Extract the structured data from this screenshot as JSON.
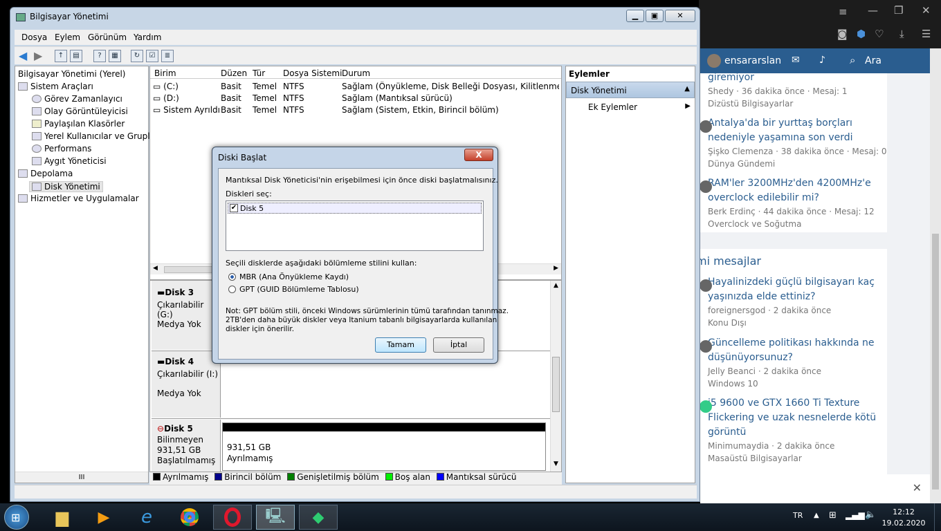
{
  "window": {
    "title": "Bilgisayar Yönetimi"
  },
  "menu": [
    "Dosya",
    "Eylem",
    "Görünüm",
    "Yardım"
  ],
  "tree": {
    "root": "Bilgisayar Yönetimi (Yerel)",
    "items": [
      "Sistem Araçları",
      "Görev Zamanlayıcı",
      "Olay Görüntüleyicisi",
      "Paylaşılan Klasörler",
      "Yerel Kullanıcılar ve Gruplar",
      "Performans",
      "Aygıt Yöneticisi",
      "Depolama",
      "Disk Yönetimi",
      "Hizmetler ve Uygulamalar"
    ],
    "scroll": "III"
  },
  "volumes": {
    "headers": [
      "Birim",
      "Düzen",
      "Tür",
      "Dosya Sistemi",
      "Durum"
    ],
    "rows": [
      [
        "(C:)",
        "Basit",
        "Temel",
        "NTFS",
        "Sağlam (Önyükleme, Disk Belleği Dosyası, Kilitlenme Bilgisi, B"
      ],
      [
        "(D:)",
        "Basit",
        "Temel",
        "NTFS",
        "Sağlam (Mantıksal sürücü)"
      ],
      [
        "Sistem Ayrıldı",
        "Basit",
        "Temel",
        "NTFS",
        "Sağlam (Sistem, Etkin, Birincil bölüm)"
      ]
    ]
  },
  "disks": [
    {
      "name": "Disk 3",
      "type": "Çıkarılabilir (G:)",
      "media": "Medya Yok"
    },
    {
      "name": "Disk 4",
      "type": "Çıkarılabilir (I:)",
      "media": "Medya Yok"
    },
    {
      "name": "Disk 5",
      "type": "Bilinmeyen",
      "size": "931,51 GB",
      "state": "Başlatılmamış",
      "part_size": "931,51 GB",
      "part_state": "Ayrılmamış"
    }
  ],
  "legend": [
    {
      "label": "Ayrılmamış",
      "color": "#000000"
    },
    {
      "label": "Birincil bölüm",
      "color": "#00008b"
    },
    {
      "label": "Genişletilmiş bölüm",
      "color": "#008000"
    },
    {
      "label": "Boş alan",
      "color": "#00ee00"
    },
    {
      "label": "Mantıksal sürücü",
      "color": "#0000ff"
    }
  ],
  "actions": {
    "title": "Eylemler",
    "section": "Disk Yönetimi",
    "item": "Ek Eylemler"
  },
  "dialog": {
    "title": "Diski Başlat",
    "intro": "Mantıksal Disk Yöneticisi'nin erişebilmesi için önce diski başlatmalısınız.",
    "select_label": "Diskleri seç:",
    "disk_item": "Disk 5",
    "style_label": "Seçili disklerde aşağıdaki bölümleme stilini kullan:",
    "option_mbr": "MBR (Ana Önyükleme Kaydı)",
    "option_gpt": "GPT (GUID Bölümleme Tablosu)",
    "note1": "Not: GPT bölüm stili, önceki Windows sürümlerinin tümü tarafından tanınmaz.",
    "note2": "2TB'den daha büyük diskler veya Itanium tabanlı bilgisayarlarda kullanılan",
    "note3": "diskler için önerilir.",
    "ok": "Tamam",
    "cancel": "İptal",
    "close": "X"
  },
  "forum": {
    "user": "ensararslan",
    "search": "Ara",
    "section": "mi mesajlar",
    "items": [
      {
        "title": "giremiyor",
        "meta": "Shedy · 36 dakika önce · Mesaj: 1",
        "cat": "Dizüstü Bilgisayarlar"
      },
      {
        "title1": "Antalya'da bir yurttaş borçları",
        "title2": "nedeniyle yaşamına son verdi",
        "meta": "Şişko Clemenza · 38 dakika önce · Mesaj: 0",
        "cat": "Dünya Gündemi"
      },
      {
        "title1": "RAM'ler 3200MHz'den 4200MHz'e",
        "title2": "overclock edilebilir mi?",
        "meta": "Berk Erdinç · 44 dakika önce · Mesaj: 12",
        "cat": "Overclock ve Soğutma"
      },
      {
        "title1": "Hayalinizdeki güçlü bilgisayarı kaç",
        "title2": "yaşınızda elde ettiniz?",
        "meta": "foreignersgod · 2 dakika önce",
        "cat": "Konu Dışı"
      },
      {
        "title1": "Güncelleme politikası hakkında ne",
        "title2": "düşünüyorsunuz?",
        "meta": "Jelly Beanci · 2 dakika önce",
        "cat": "Windows 10"
      },
      {
        "title1": "i5 9600 ve GTX 1660 Ti Texture",
        "title2": "Flickering ve uzak nesnelerde kötü",
        "title3": "görüntü",
        "meta": "Minimumaydia · 2 dakika önce",
        "cat": "Masaüstü Bilgisayarlar"
      }
    ]
  },
  "taskbar": {
    "lang": "TR",
    "time": "12:12",
    "date": "19.02.2020"
  }
}
